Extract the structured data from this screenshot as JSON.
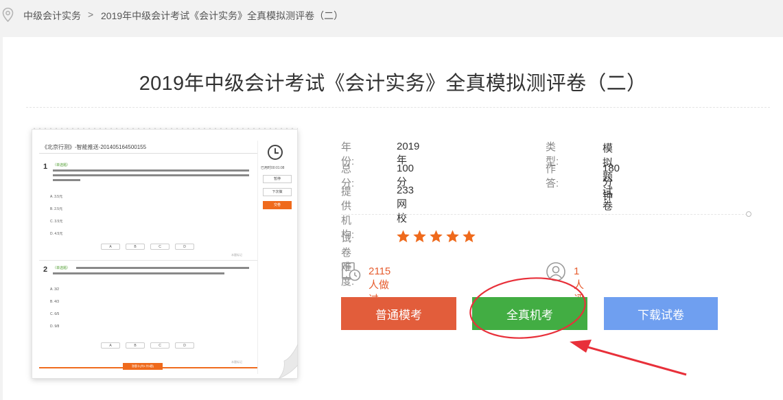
{
  "breadcrumb": {
    "items": [
      "中级会计实务",
      "2019年中级会计考试《会计实务》全真模拟测评卷（二）"
    ],
    "separator": ">"
  },
  "title": "2019年中级会计考试《会计实务》全真模拟测评卷（二）",
  "preview": {
    "header": "《北京行测》-智能推送-201405164500155",
    "elapsed": "已用时00:01:08",
    "side_buttons": [
      "暂停",
      "下次做",
      "交卷"
    ],
    "q1": {
      "num": "1",
      "tag": "（单选题）",
      "options": [
        "A. 3.5元",
        "B. 2.5元",
        "C. 3.5元",
        "D. 4.5元"
      ]
    },
    "q2": {
      "num": "2",
      "tag": "（单选题）",
      "options": [
        "A. 3/2",
        "B. 4/3",
        "C. 6/5",
        "D. 9/8"
      ]
    },
    "choices": [
      "A",
      "B",
      "C",
      "D"
    ],
    "mark_label": "本题标记",
    "bottom_button": "答题卡(共5 共5题)"
  },
  "info": {
    "year_label": "年　　份:",
    "year_value": "2019 年",
    "type_label": "类　　型:",
    "type_value": "模拟题试卷",
    "score_label": "总　　分:",
    "score_value": "100 分",
    "time_label": "作　　答:",
    "time_value": "180 分钟",
    "org_label": "提供机构:",
    "org_value": "233网校",
    "difficulty_label": "试卷难度:",
    "difficulty_stars": 5,
    "done_count": "2115 人做过",
    "review_count": "1 人评论"
  },
  "buttons": {
    "normal": "普通模考",
    "real": "全真机考",
    "download": "下载试卷"
  },
  "colors": {
    "orange": "#e25d3b",
    "green": "#42ad43",
    "blue": "#6f9ff0",
    "star": "#ef6a1c",
    "annotation": "#e8303a"
  }
}
